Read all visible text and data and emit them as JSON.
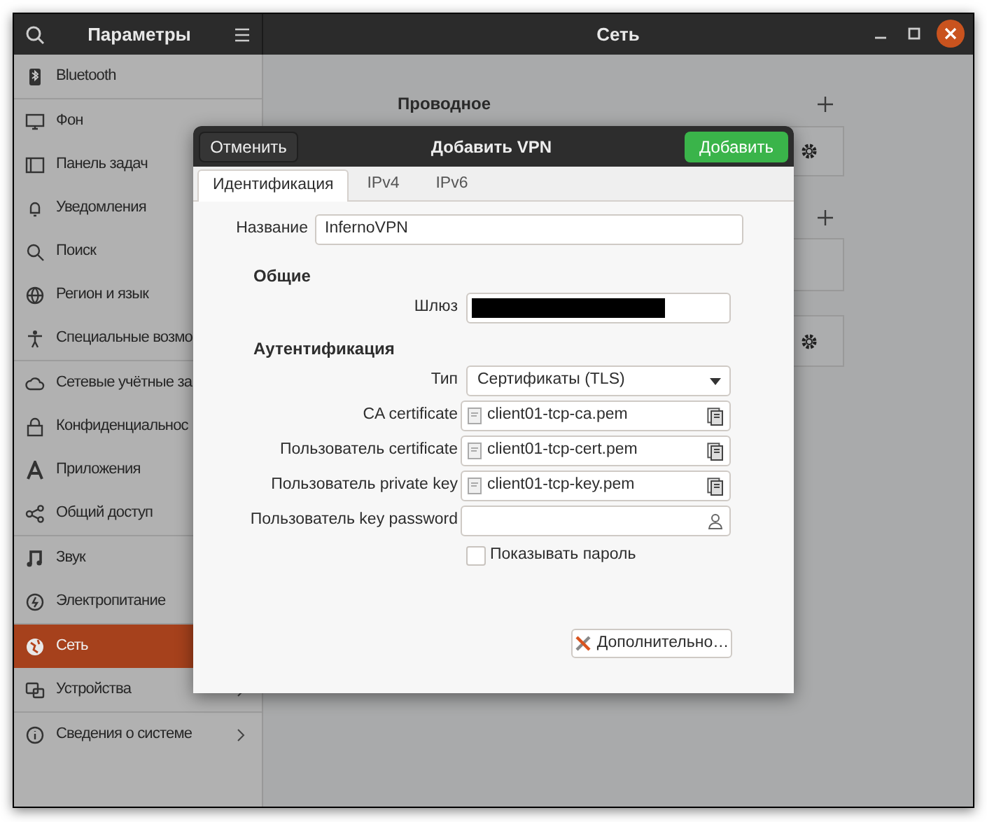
{
  "window": {
    "sidebar_title": "Параметры",
    "title": "Сеть"
  },
  "sidebar": {
    "groups": [
      {
        "items": [
          {
            "label": "Bluetooth",
            "selected": false
          }
        ]
      },
      {
        "items": [
          {
            "label": "Фон",
            "selected": false
          },
          {
            "label": "Панель задач",
            "selected": false
          },
          {
            "label": "Уведомления",
            "selected": false
          },
          {
            "label": "Поиск",
            "selected": false
          },
          {
            "label": "Регион и язык",
            "selected": false
          },
          {
            "label": "Специальные возмо",
            "selected": false
          }
        ]
      },
      {
        "items": [
          {
            "label": "Сетевые учётные за",
            "selected": false
          },
          {
            "label": "Конфиденциальнос",
            "selected": false
          },
          {
            "label": "Приложения",
            "selected": false
          },
          {
            "label": "Общий доступ",
            "selected": false
          }
        ]
      },
      {
        "items": [
          {
            "label": "Звук",
            "selected": false
          },
          {
            "label": "Электропитание",
            "selected": false
          }
        ]
      },
      {
        "items": [
          {
            "label": "Сеть",
            "selected": true
          },
          {
            "label": "Устройства",
            "selected": false,
            "chevron": true
          }
        ]
      },
      {
        "items": [
          {
            "label": "Сведения о системе",
            "selected": false,
            "chevron": true
          }
        ]
      }
    ]
  },
  "content": {
    "section_title": "Проводное"
  },
  "dialog": {
    "title": "Добавить VPN",
    "cancel": "Отменить",
    "confirm": "Добавить",
    "tabs": [
      {
        "label": "Идентификация",
        "selected": true
      },
      {
        "label": "IPv4",
        "selected": false
      },
      {
        "label": "IPv6",
        "selected": false
      }
    ],
    "name": {
      "label": "Название",
      "value": "InfernoVPN"
    },
    "sections": [
      {
        "title": "Общие",
        "fields": [
          {
            "kind": "text",
            "label": "Шлюз",
            "redacted": true
          }
        ]
      },
      {
        "title": "Аутентификация",
        "fields": [
          {
            "kind": "dropdown",
            "label": "Тип",
            "value": "Сертификаты (TLS)"
          },
          {
            "kind": "file",
            "label": "CA certificate",
            "value": "client01-tcp-ca.pem"
          },
          {
            "kind": "file",
            "label": "Пользователь certificate",
            "value": "client01-tcp-cert.pem"
          },
          {
            "kind": "file",
            "label": "Пользователь private key",
            "value": "client01-tcp-key.pem"
          },
          {
            "kind": "password",
            "label": "Пользователь key password"
          },
          {
            "kind": "checkbox",
            "label": "Показывать пароль",
            "checked": false
          }
        ]
      }
    ],
    "advanced_button": "Дополнительно…"
  }
}
